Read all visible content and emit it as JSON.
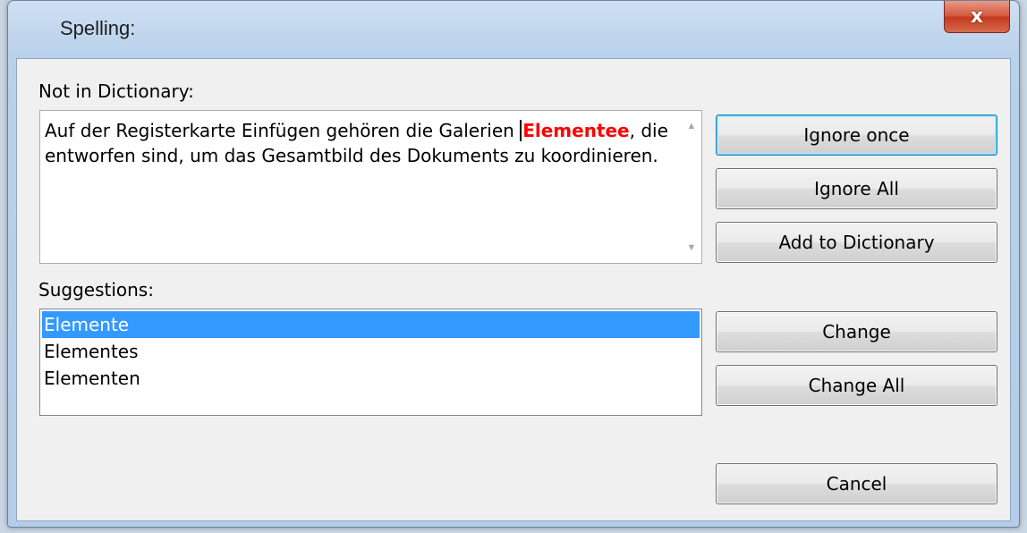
{
  "window": {
    "title": "Spelling:",
    "close_glyph": "x"
  },
  "not_in_dictionary": {
    "label": "Not in Dictionary:",
    "text_before": "Auf der Registerkarte Einfügen gehören die Galerien ",
    "misspelled_word": "Elementee",
    "text_after": ", die entworfen sind, um das Gesamtbild des Dokuments zu koordinieren.",
    "misspelled_color": "#ff0000"
  },
  "suggestions": {
    "label": "Suggestions:",
    "items": [
      "Elemente",
      "Elementes",
      "Elementen"
    ],
    "selected": "Elemente",
    "selection_color": "#3399ff"
  },
  "buttons": {
    "ignore_once": "Ignore once",
    "ignore_all": "Ignore All",
    "add_to_dictionary": "Add to Dictionary",
    "change": "Change",
    "change_all": "Change All",
    "cancel": "Cancel"
  },
  "icons": {
    "scroll_up": "scroll-up-arrow-icon",
    "scroll_down": "scroll-down-arrow-icon",
    "close": "close-icon"
  }
}
